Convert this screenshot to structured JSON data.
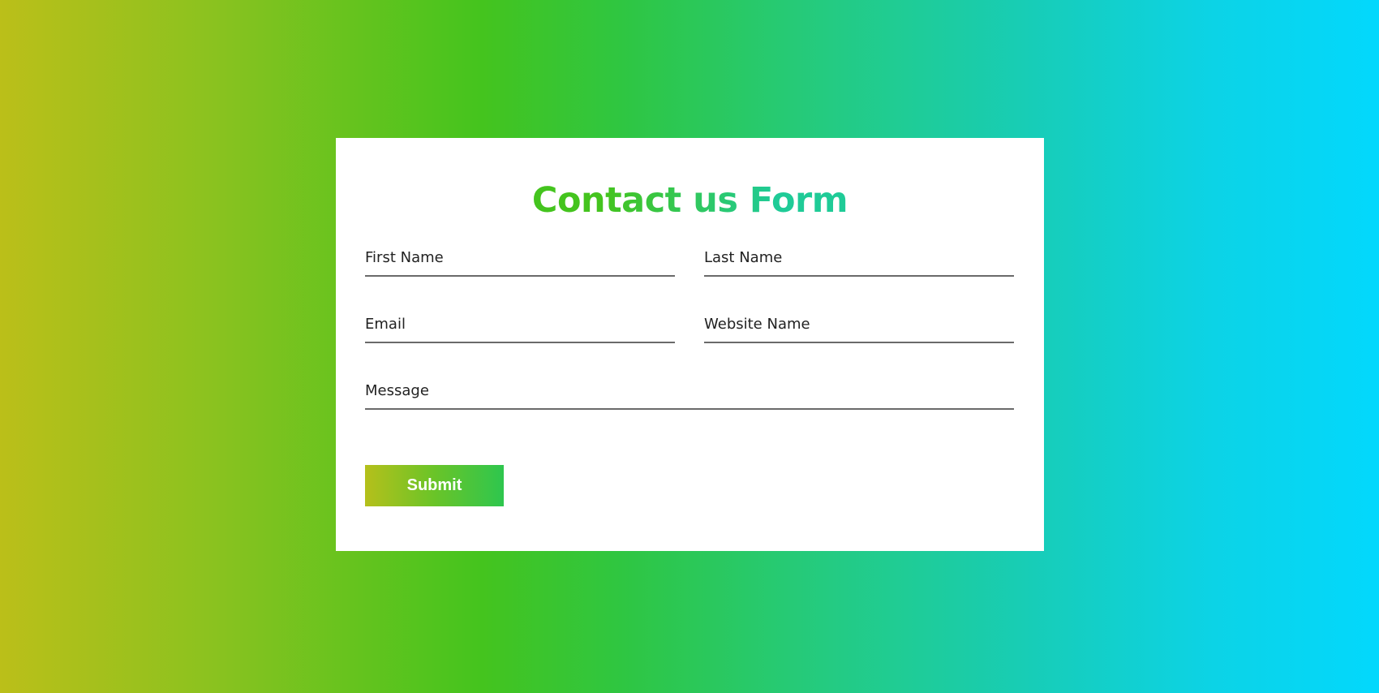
{
  "form": {
    "title": "Contact us Form",
    "fields": {
      "first_name": {
        "placeholder": "First Name",
        "value": ""
      },
      "last_name": {
        "placeholder": "Last Name",
        "value": ""
      },
      "email": {
        "placeholder": "Email",
        "value": ""
      },
      "website_name": {
        "placeholder": "Website Name",
        "value": ""
      },
      "message": {
        "placeholder": "Message",
        "value": ""
      }
    },
    "submit_label": "Submit"
  },
  "colors": {
    "background_gradient": [
      "#bbbf19",
      "#44c41e",
      "#24cb81",
      "#02d8fd"
    ],
    "title_gradient": [
      "#44c41e",
      "#1fcb97"
    ],
    "button_gradient": [
      "#b5c01b",
      "#2ec64e"
    ],
    "card": "#ffffff",
    "field_underline": "#6a6a6a",
    "text": "#222222"
  }
}
